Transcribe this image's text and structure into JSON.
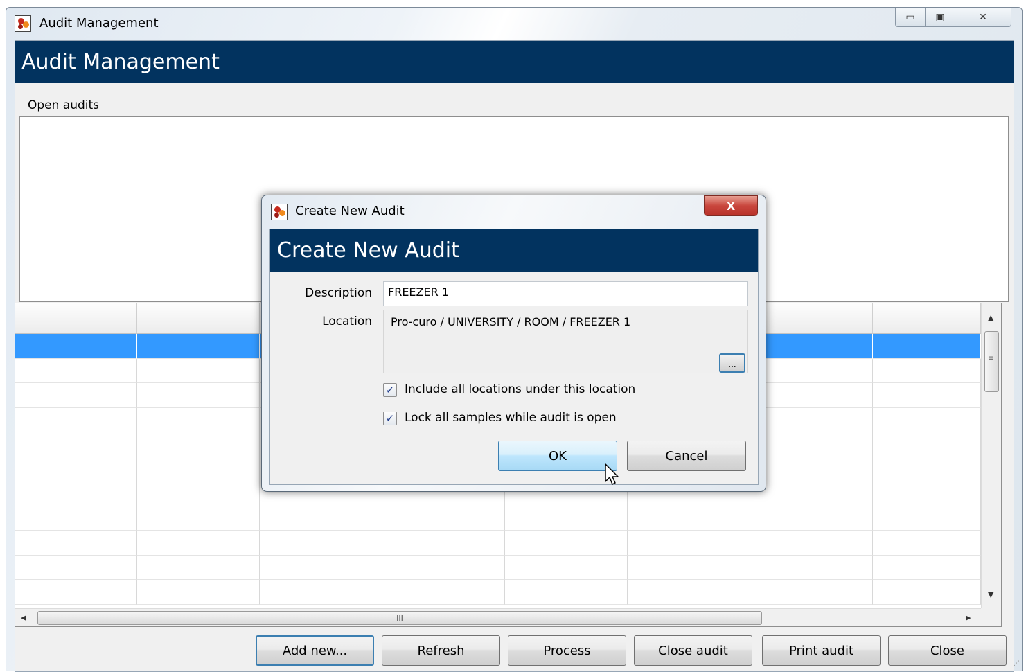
{
  "window": {
    "title": "Audit Management",
    "banner": "Audit Management",
    "minimize_glyph": "▭",
    "maximize_glyph": "▣",
    "close_glyph": "✕"
  },
  "open_audits": {
    "label": "Open audits"
  },
  "grid": {
    "columns": [
      "",
      "",
      "",
      "",
      "",
      "",
      "",
      ""
    ],
    "selected_row": 0,
    "row_count": 11,
    "scroll_up_glyph": "▲",
    "scroll_down_glyph": "▼",
    "scroll_left_glyph": "◂",
    "scroll_right_glyph": "▸",
    "grip_glyph": "III"
  },
  "buttons": {
    "add_new": "Add new...",
    "refresh": "Refresh",
    "process": "Process",
    "close_audit": "Close audit",
    "print_audit": "Print audit",
    "close": "Close"
  },
  "dialog": {
    "title": "Create New Audit",
    "banner": "Create New Audit",
    "close_glyph": "X",
    "description_label": "Description",
    "description_value": "FREEZER 1",
    "location_label": "Location",
    "location_value": "Pro-curo / UNIVERSITY / ROOM / FREEZER 1",
    "browse_label": "...",
    "include_all_label": "Include all locations under this location",
    "include_all_checked": true,
    "lock_samples_label": "Lock all samples while audit is open",
    "lock_samples_checked": true,
    "check_glyph": "✓",
    "ok_label": "OK",
    "cancel_label": "Cancel"
  },
  "colors": {
    "banner": "#02335f",
    "selection": "#3399ff",
    "dialog_close": "#c9463d"
  }
}
